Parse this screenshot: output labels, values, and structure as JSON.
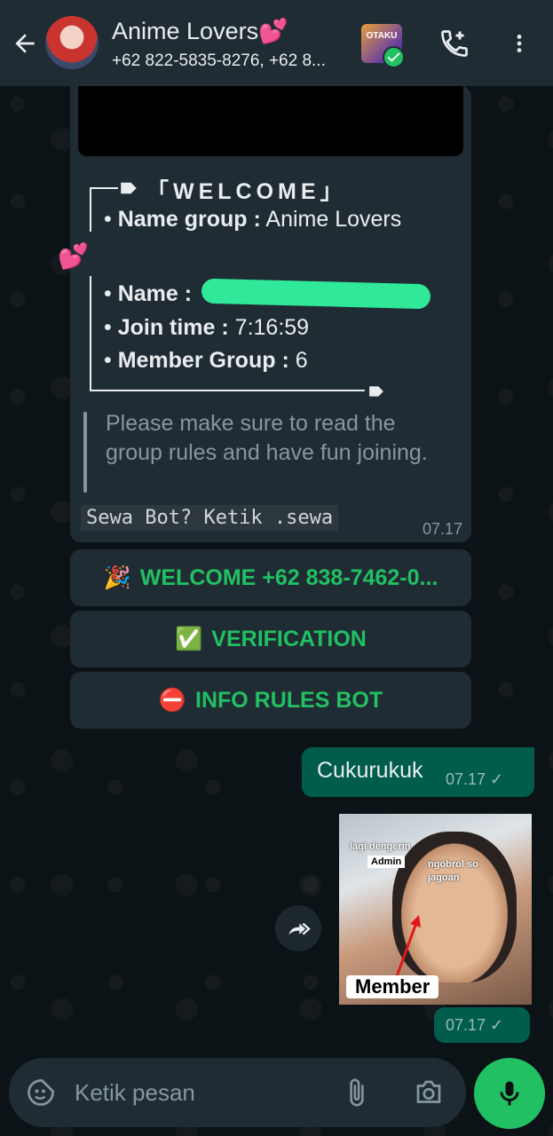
{
  "header": {
    "title": "Anime Lovers💕",
    "subtitle": "+62 822-5835-8276, +62 8...",
    "group_icon_text": "OTAKU"
  },
  "welcome_message": {
    "heading": "「WELCOME」",
    "name_group_label": "Name group :",
    "name_group_value": "Anime Lovers",
    "hearts": "💕",
    "name_label": "Name :",
    "join_time_label": "Join time :",
    "join_time_value": "7:16:59",
    "member_group_label": "Member Group :",
    "member_group_value": "6",
    "quote": "Please make sure to read the group rules and have fun joining.",
    "mono_text": "Sewa Bot? Ketik .sewa",
    "time": "07.17"
  },
  "buttons": [
    {
      "icon": "🎉",
      "label": "WELCOME +62 838-7462-0..."
    },
    {
      "icon": "✅",
      "label": "VERIFICATION"
    },
    {
      "icon": "⛔",
      "label": "INFO RULES BOT"
    }
  ],
  "outgoing_text": {
    "text": "Cukurukuk",
    "time": "07.17 ✓"
  },
  "outgoing_photo": {
    "caption_1": "lagi dengerin",
    "caption_admin": "Admin",
    "caption_2": "ngobrol so jagoan",
    "member_label": "Member",
    "time": "07.17 ✓"
  },
  "composer": {
    "placeholder": "Ketik pesan"
  },
  "colors": {
    "accent": "#21c063",
    "header": "#1f2c33",
    "bubble_in": "#202c33",
    "bubble_out": "#005c4b"
  }
}
